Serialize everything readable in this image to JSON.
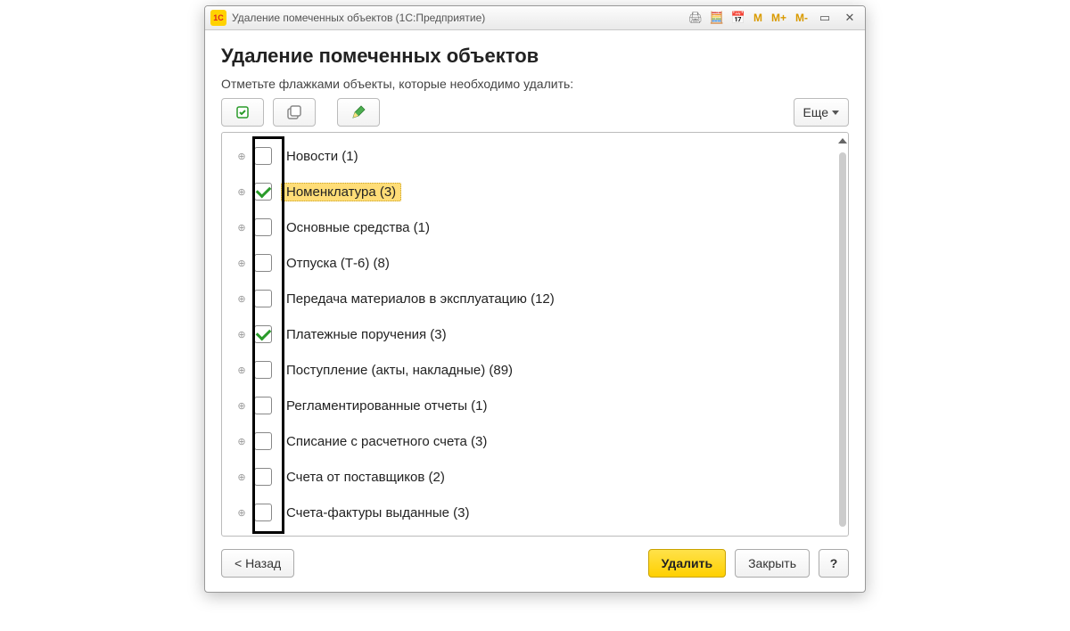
{
  "window": {
    "title": "Удаление помеченных объектов  (1С:Предприятие)"
  },
  "page": {
    "heading": "Удаление помеченных объектов",
    "subtitle": "Отметьте флажками объекты, которые необходимо удалить:",
    "more_label": "Еще"
  },
  "toolbar_icons": {
    "check_all": "check-all-icon",
    "uncheck_all": "uncheck-all-icon",
    "edit": "edit-icon"
  },
  "items": [
    {
      "label": "Новости (1)",
      "checked": false,
      "highlighted": false
    },
    {
      "label": "Номенклатура (3)",
      "checked": true,
      "highlighted": true
    },
    {
      "label": "Основные средства (1)",
      "checked": false,
      "highlighted": false
    },
    {
      "label": "Отпуска (Т-6) (8)",
      "checked": false,
      "highlighted": false
    },
    {
      "label": "Передача материалов в эксплуатацию (12)",
      "checked": false,
      "highlighted": false
    },
    {
      "label": "Платежные поручения (3)",
      "checked": true,
      "highlighted": false
    },
    {
      "label": "Поступление (акты, накладные) (89)",
      "checked": false,
      "highlighted": false
    },
    {
      "label": "Регламентированные отчеты (1)",
      "checked": false,
      "highlighted": false
    },
    {
      "label": "Списание с расчетного счета (3)",
      "checked": false,
      "highlighted": false
    },
    {
      "label": "Счета от поставщиков (2)",
      "checked": false,
      "highlighted": false
    },
    {
      "label": "Счета-фактуры выданные (3)",
      "checked": false,
      "highlighted": false
    }
  ],
  "footer": {
    "back": "< Назад",
    "delete": "Удалить",
    "close": "Закрыть",
    "help": "?"
  }
}
